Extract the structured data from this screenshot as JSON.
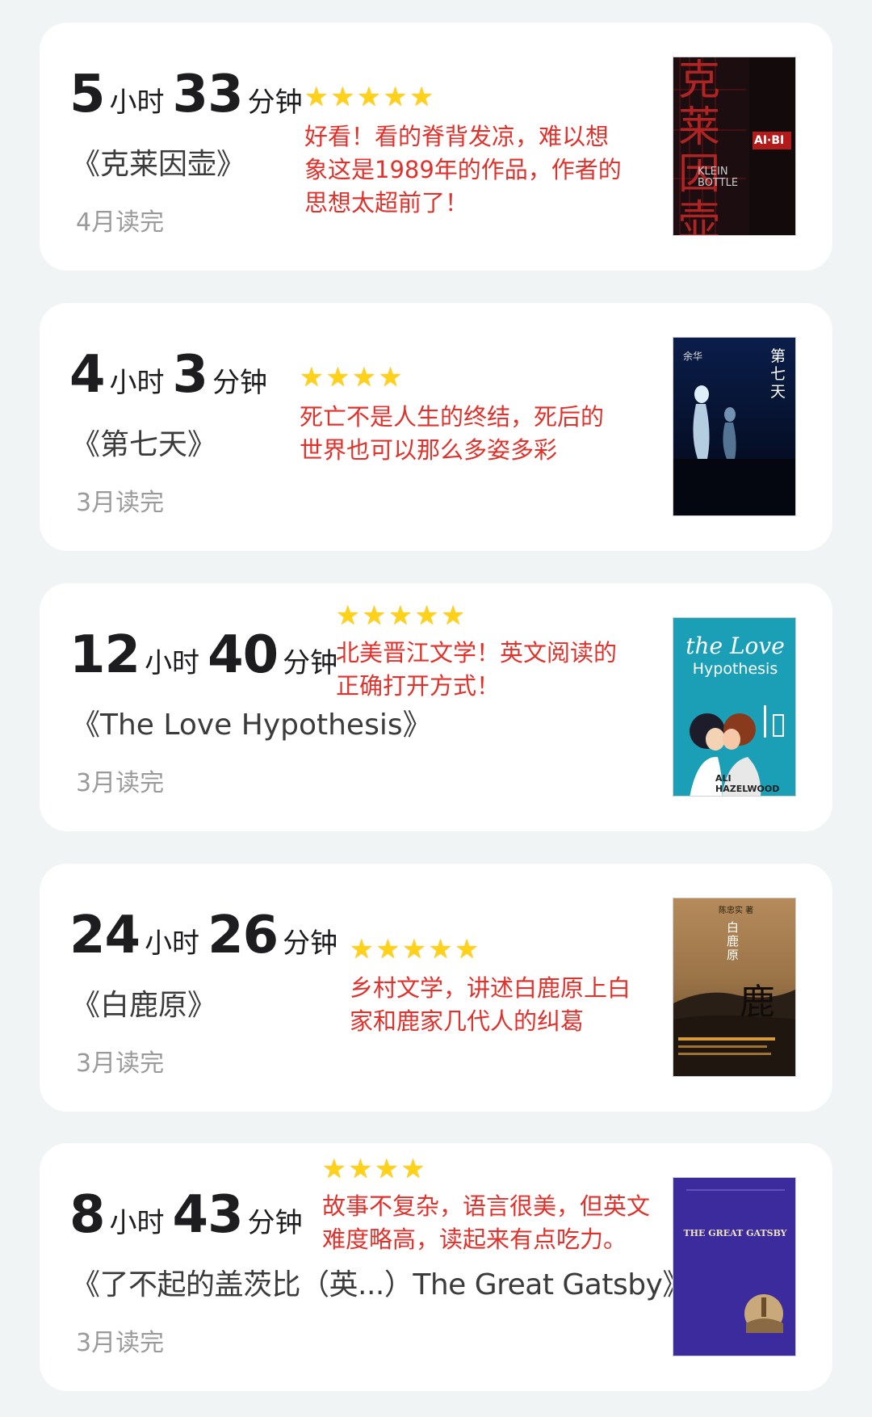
{
  "books": [
    {
      "hours": "5",
      "minutes": "33",
      "unit_hour": "小时",
      "unit_minute": "分钟",
      "title": "《克莱因壶》",
      "date": "4月读完",
      "stars": "★★★★★",
      "rating": 5,
      "review": "好看！看的脊背发凉，难以想象这是1989年的作品，作者的思想太超前了！",
      "cover": {
        "title": "克莱因壶",
        "subtitle": "KLEIN BOTTLE",
        "tag": "AI·BI"
      }
    },
    {
      "hours": "4",
      "minutes": "3",
      "unit_hour": "小时",
      "unit_minute": "分钟",
      "title": "《第七天》",
      "date": "3月读完",
      "stars": "★★★★",
      "rating": 4,
      "review": "死亡不是人生的终结，死后的世界也可以那么多姿多彩",
      "cover": {
        "title": "第七天",
        "author": "余华"
      }
    },
    {
      "hours": "12",
      "minutes": "40",
      "unit_hour": "小时",
      "unit_minute": "分钟",
      "title": "《The Love Hypothesis》",
      "date": "3月读完",
      "stars": "★★★★★",
      "rating": 5,
      "review": "北美晋江文学！英文阅读的正确打开方式！",
      "cover": {
        "title_line1": "the Love",
        "title_line2": "Hypothesis",
        "author": "ALI HAZELWOOD"
      }
    },
    {
      "hours": "24",
      "minutes": "26",
      "unit_hour": "小时",
      "unit_minute": "分钟",
      "title": "《白鹿原》",
      "date": "3月读完",
      "stars": "★★★★★",
      "rating": 5,
      "review": "乡村文学，讲述白鹿原上白家和鹿家几代人的纠葛",
      "cover": {
        "title": "白鹿原",
        "author": "陈忠实 著",
        "glyph": "鹿"
      }
    },
    {
      "hours": "8",
      "minutes": "43",
      "unit_hour": "小时",
      "unit_minute": "分钟",
      "title": "《了不起的盖茨比（英...）The Great Gatsby》",
      "date": "3月读完",
      "stars": "★★★★",
      "rating": 4,
      "review": "故事不复杂，语言很美，但英文难度略高，读起来有点吃力。",
      "cover": {
        "title": "THE GREAT GATSBY"
      }
    }
  ],
  "colors": {
    "review": "#e0322c",
    "star": "#ffd21a",
    "background": "#f1f4f4"
  }
}
